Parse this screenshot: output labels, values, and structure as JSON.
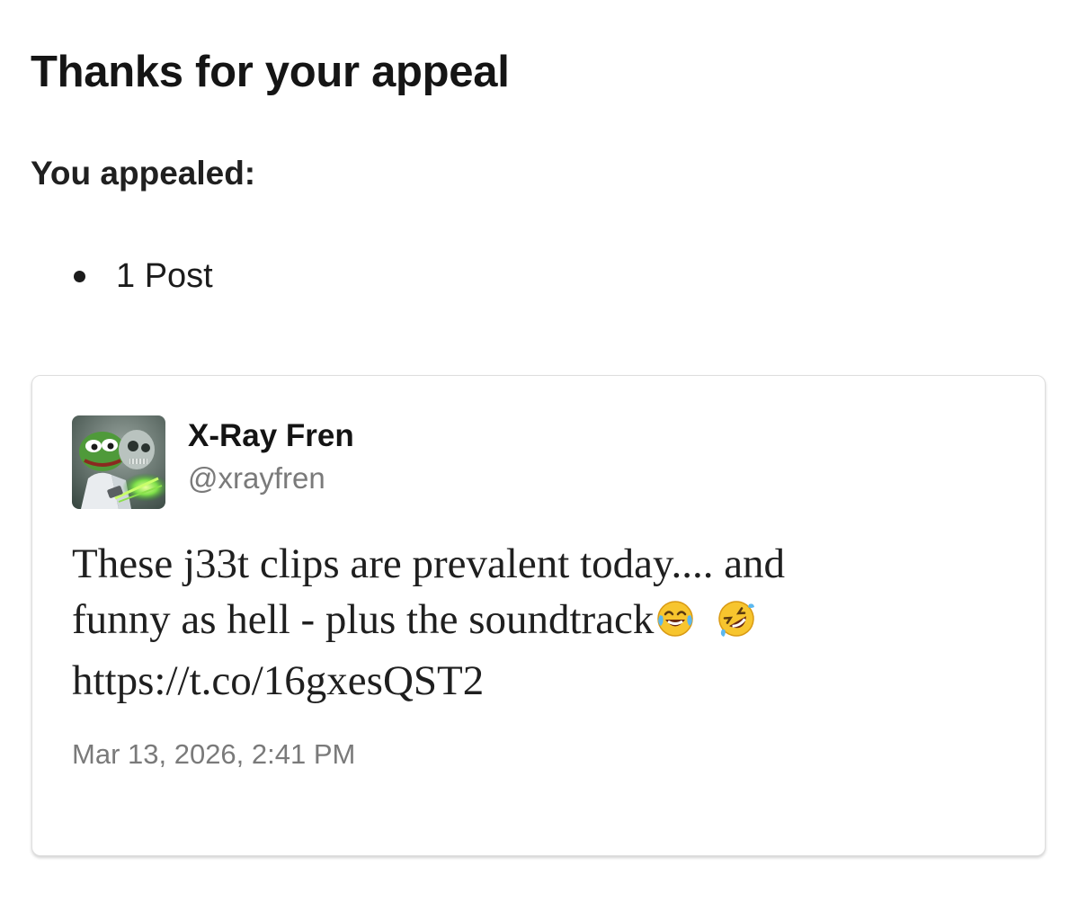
{
  "page": {
    "title": "Thanks for your appeal",
    "subtitle": "You appealed:",
    "appealed_items": [
      "1 Post"
    ]
  },
  "post": {
    "display_name": "X-Ray Fren",
    "handle": "@xrayfren",
    "text_line1": "These j33t clips are prevalent today.... and",
    "text_line2": "funny as hell - plus the soundtrack",
    "text_line3": "https://t.co/16gxesQST2",
    "emojis": [
      "😂",
      "🤣"
    ],
    "timestamp": "Mar 13, 2026, 2:41 PM",
    "avatar_icon": "pepe-xray-avatar-icon"
  },
  "colors": {
    "text_primary": "#151515",
    "text_secondary": "#7a7a7a",
    "card_border": "#dedede",
    "background": "#ffffff"
  }
}
